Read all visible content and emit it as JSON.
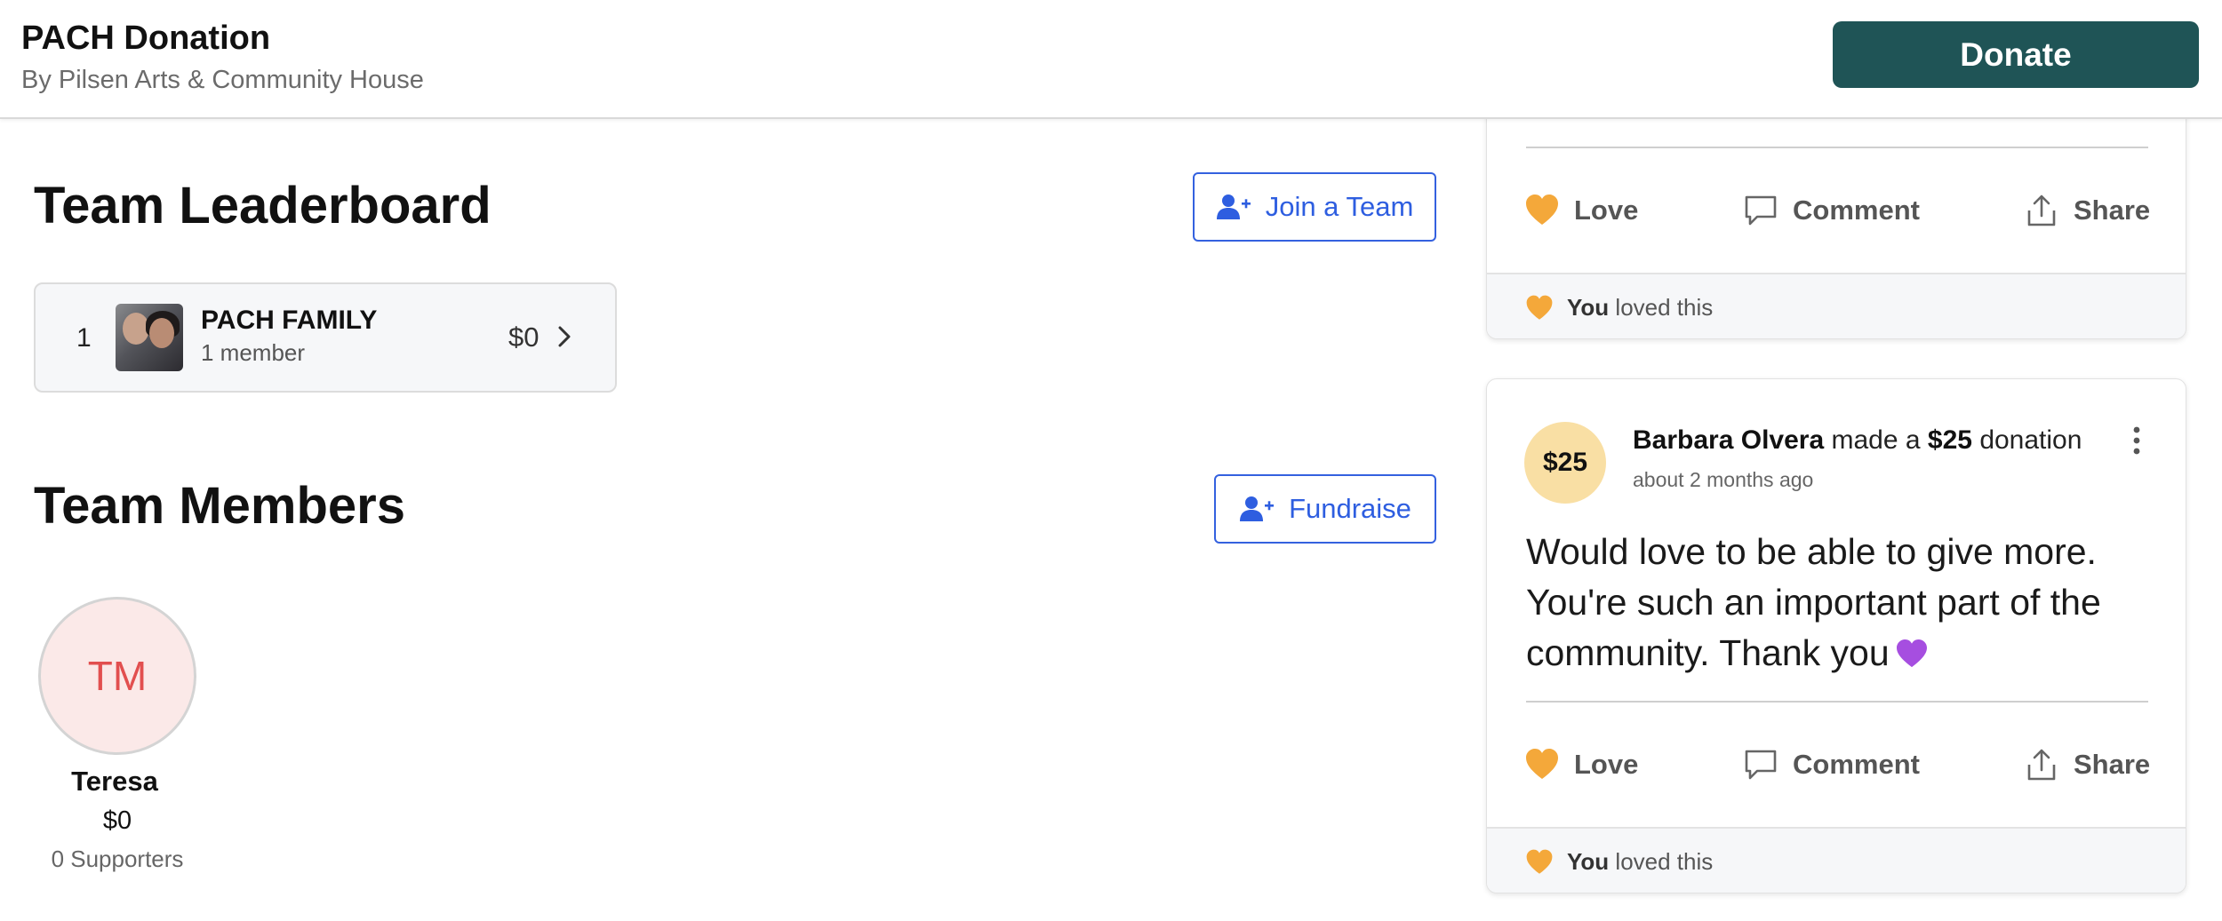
{
  "header": {
    "title": "PACH Donation",
    "subtitle": "By Pilsen Arts & Community House",
    "donate_label": "Donate",
    "brand_color": "#1f5456"
  },
  "leaderboard": {
    "title": "Team Leaderboard",
    "join_label": "Join a Team",
    "teams": [
      {
        "rank": "1",
        "name": "PACH FAMILY",
        "members": "1 member",
        "amount": "$0"
      }
    ]
  },
  "members_section": {
    "title": "Team Members",
    "fundraise_label": "Fundraise",
    "members": [
      {
        "initials": "TM",
        "name": "Teresa",
        "amount": "$0",
        "supporters": "0 Supporters"
      }
    ]
  },
  "feed": {
    "actions": {
      "love": "Love",
      "comment": "Comment",
      "share": "Share"
    },
    "posts": [
      {
        "loved_you": "You",
        "loved_rest": "loved this"
      },
      {
        "badge": "$25",
        "donor": "Barbara Olvera",
        "made_a": "made a",
        "amount": "$25",
        "donation": "donation",
        "time": "about 2 months ago",
        "message": "Would love to be able to give more. You're such an important part of the community. Thank you",
        "loved_you": "You",
        "loved_rest": "loved this"
      }
    ]
  },
  "colors": {
    "link_blue": "#2e5ee0",
    "heart_orange": "#f4a83a",
    "donation_badge": "#f9dfa4",
    "avatar_initials": "#e24f4f"
  }
}
